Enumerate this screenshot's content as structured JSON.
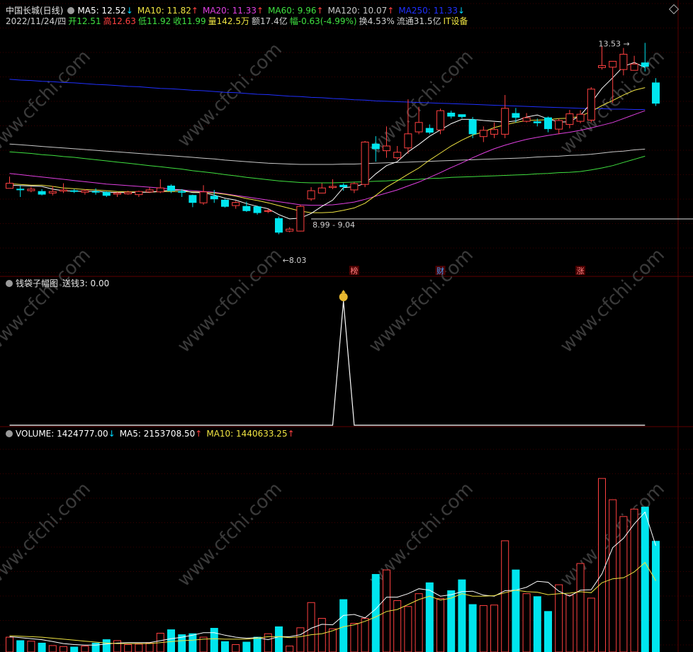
{
  "header": {
    "stock_name": "中国长城(日线)",
    "ma_lines": [
      {
        "label": "MA5: 12.52",
        "arrow": "↓",
        "color": "#ffffff",
        "arrow_color": "#00d8ff"
      },
      {
        "label": "MA10: 11.82",
        "arrow": "↑",
        "color": "#f0e442",
        "arrow_color": "#ff4040"
      },
      {
        "label": "MA20: 11.33",
        "arrow": "↑",
        "color": "#e040e0",
        "arrow_color": "#ff4040"
      },
      {
        "label": "MA60: 9.96",
        "arrow": "↑",
        "color": "#40e040",
        "arrow_color": "#ff4040"
      },
      {
        "label": "MA120: 10.07",
        "arrow": "↑",
        "color": "#c8c8c8",
        "arrow_color": "#ff4040"
      },
      {
        "label": "MA250: 11.33",
        "arrow": "↓",
        "color": "#2030ff",
        "arrow_color": "#00d8ff"
      }
    ],
    "info": [
      {
        "text": "2022/11/24/四",
        "color": "#d0d0d0"
      },
      {
        "text": "开12.51",
        "color": "#40e040"
      },
      {
        "text": "高12.63",
        "color": "#ff4040"
      },
      {
        "text": "低11.92",
        "color": "#40e040"
      },
      {
        "text": "收11.99",
        "color": "#40e040"
      },
      {
        "text": "量142.5万",
        "color": "#f0e442"
      },
      {
        "text": "额17.4亿",
        "color": "#d0d0d0"
      },
      {
        "text": "幅-0.63(-4.99%)",
        "color": "#40e040"
      },
      {
        "text": "换4.53%",
        "color": "#d0d0d0"
      },
      {
        "text": "流通31.5亿",
        "color": "#d0d0d0"
      },
      {
        "text": "IT设备",
        "color": "#f0e442"
      }
    ]
  },
  "indicator": {
    "name": "钱袋子幅图",
    "value": "送钱3: 0.00",
    "signal_icon": "money-bag-icon"
  },
  "volume_header": {
    "items": [
      {
        "label": "VOLUME: 1424777.00",
        "arrow": "↓",
        "color": "#ffffff",
        "arrow_color": "#00d8ff"
      },
      {
        "label": "MA5: 2153708.50",
        "arrow": "↑",
        "color": "#ffffff",
        "arrow_color": "#ff4040"
      },
      {
        "label": "MA10: 1440633.25",
        "arrow": "↑",
        "color": "#f0e442",
        "arrow_color": "#ff4040"
      }
    ]
  },
  "annotations": {
    "low_label": "8.03",
    "high_label": "13.53",
    "range_label": "8.99 - 9.04",
    "events": [
      {
        "idx": 32,
        "text": "榜"
      },
      {
        "idx": 40,
        "text": "财"
      },
      {
        "idx": 53,
        "text": "涨"
      }
    ]
  },
  "watermark": "www.cfchi.com",
  "colors": {
    "up": "#ff4040",
    "down": "#00e5ee",
    "ma5": "#ffffff",
    "ma10": "#f0e442",
    "ma20": "#e040e0",
    "ma60": "#40e040",
    "ma120": "#c8c8c8",
    "ma250": "#2030ff"
  },
  "chart_data": {
    "type": "candlestick",
    "title": "中国长城(日线)",
    "price_range": [
      7.9,
      13.9
    ],
    "candles": [
      [
        9.82,
        9.95,
        10.12,
        9.85
      ],
      [
        9.8,
        9.79,
        9.88,
        9.6
      ],
      [
        9.76,
        9.8,
        9.86,
        9.72
      ],
      [
        9.74,
        9.67,
        9.8,
        9.64
      ],
      [
        9.7,
        9.74,
        9.88,
        9.64
      ],
      [
        9.75,
        9.78,
        9.95,
        9.7
      ],
      [
        9.76,
        9.74,
        9.8,
        9.7
      ],
      [
        9.72,
        9.76,
        9.8,
        9.66
      ],
      [
        9.74,
        9.73,
        9.82,
        9.66
      ],
      [
        9.72,
        9.64,
        9.74,
        9.6
      ],
      [
        9.67,
        9.7,
        9.73,
        9.6
      ],
      [
        9.68,
        9.72,
        9.76,
        9.66
      ],
      [
        9.66,
        9.74,
        9.76,
        9.6
      ],
      [
        9.73,
        9.78,
        9.84,
        9.7
      ],
      [
        9.73,
        9.83,
        10.05,
        9.7
      ],
      [
        9.88,
        9.76,
        9.92,
        9.7
      ],
      [
        9.74,
        9.72,
        9.8,
        9.6
      ],
      [
        9.64,
        9.46,
        9.66,
        9.34
      ],
      [
        9.45,
        9.73,
        9.9,
        9.4
      ],
      [
        9.62,
        9.55,
        9.78,
        9.45
      ],
      [
        9.52,
        9.36,
        9.55,
        9.33
      ],
      [
        9.38,
        9.46,
        9.5,
        9.3
      ],
      [
        9.36,
        9.25,
        9.48,
        9.22
      ],
      [
        9.35,
        9.2,
        9.38,
        9.15
      ],
      [
        9.24,
        9.25,
        9.3,
        9.19
      ],
      [
        9.05,
        8.7,
        9.1,
        8.65
      ],
      [
        8.73,
        8.78,
        8.83,
        8.7
      ],
      [
        8.73,
        9.36,
        9.4,
        8.72
      ],
      [
        9.55,
        9.76,
        9.85,
        9.5
      ],
      [
        9.7,
        9.83,
        9.95,
        9.7
      ],
      [
        9.84,
        9.87,
        10.05,
        9.8
      ],
      [
        9.9,
        9.86,
        9.95,
        9.76
      ],
      [
        9.78,
        9.94,
        9.98,
        9.7
      ],
      [
        9.92,
        11.0,
        11.03,
        9.85
      ],
      [
        10.95,
        10.83,
        11.15,
        10.5
      ],
      [
        10.78,
        10.9,
        11.4,
        10.6
      ],
      [
        10.6,
        10.74,
        10.9,
        10.55
      ],
      [
        10.85,
        11.21,
        12.09,
        10.7
      ],
      [
        11.26,
        11.5,
        11.9,
        11.2
      ],
      [
        11.35,
        11.25,
        11.45,
        11.2
      ],
      [
        11.31,
        11.8,
        11.85,
        11.2
      ],
      [
        11.74,
        11.66,
        11.8,
        11.6
      ],
      [
        11.7,
        11.65,
        11.7,
        11.6
      ],
      [
        11.57,
        11.21,
        11.64,
        11.1
      ],
      [
        11.14,
        11.3,
        11.4,
        11.0
      ],
      [
        11.2,
        11.32,
        11.5,
        11.1
      ],
      [
        11.2,
        11.86,
        12.2,
        11.1
      ],
      [
        11.73,
        11.63,
        11.87,
        11.5
      ],
      [
        11.53,
        11.62,
        11.74,
        11.5
      ],
      [
        11.52,
        11.49,
        11.6,
        11.4
      ],
      [
        11.62,
        11.34,
        11.65,
        11.25
      ],
      [
        11.33,
        11.55,
        11.6,
        11.2
      ],
      [
        11.45,
        11.72,
        11.82,
        11.35
      ],
      [
        11.53,
        11.71,
        11.81,
        11.48
      ],
      [
        11.56,
        12.35,
        12.4,
        11.5
      ],
      [
        12.9,
        12.95,
        13.45,
        12.85
      ],
      [
        12.91,
        13.06,
        13.06,
        12.0
      ],
      [
        12.85,
        13.24,
        13.4,
        12.7
      ],
      [
        12.83,
        12.99,
        13.2,
        12.85
      ],
      [
        13.02,
        12.93,
        13.53,
        12.8
      ],
      [
        12.51,
        11.99,
        12.63,
        11.92
      ]
    ],
    "ma5": [
      9.9,
      9.89,
      9.88,
      9.87,
      9.8,
      9.76,
      9.75,
      9.74,
      9.75,
      9.72,
      9.71,
      9.71,
      9.72,
      9.72,
      9.75,
      9.77,
      9.78,
      9.71,
      9.71,
      9.65,
      9.57,
      9.52,
      9.43,
      9.36,
      9.3,
      9.15,
      9.04,
      9.06,
      9.18,
      9.36,
      9.52,
      9.84,
      9.86,
      9.94,
      10.19,
      10.4,
      10.5,
      10.75,
      10.94,
      11.15,
      11.31,
      11.47,
      11.58,
      11.58,
      11.55,
      11.53,
      11.51,
      11.54,
      11.64,
      11.69,
      11.59,
      11.51,
      11.52,
      11.68,
      12.0,
      12.37,
      12.64,
      12.93,
      13.03,
      12.9,
      12.52
    ],
    "ma10": [
      9.94,
      9.92,
      9.9,
      9.9,
      9.87,
      9.83,
      9.81,
      9.79,
      9.78,
      9.76,
      9.74,
      9.73,
      9.73,
      9.72,
      9.74,
      9.74,
      9.74,
      9.73,
      9.72,
      9.7,
      9.67,
      9.62,
      9.56,
      9.51,
      9.45,
      9.38,
      9.31,
      9.24,
      9.2,
      9.2,
      9.21,
      9.26,
      9.32,
      9.44,
      9.64,
      9.85,
      10.01,
      10.18,
      10.34,
      10.54,
      10.72,
      10.9,
      11.05,
      11.18,
      11.26,
      11.37,
      11.44,
      11.5,
      11.55,
      11.56,
      11.57,
      11.6,
      11.61,
      11.66,
      11.78,
      11.93,
      12.06,
      12.2,
      12.32,
      12.39,
      11.82
    ],
    "ma20": [
      10.2,
      10.17,
      10.14,
      10.11,
      10.08,
      10.05,
      10.02,
      9.99,
      9.96,
      9.93,
      9.91,
      9.89,
      9.87,
      9.85,
      9.83,
      9.8,
      9.78,
      9.76,
      9.74,
      9.72,
      9.68,
      9.64,
      9.6,
      9.56,
      9.52,
      9.48,
      9.44,
      9.4,
      9.39,
      9.39,
      9.4,
      9.43,
      9.47,
      9.54,
      9.62,
      9.7,
      9.78,
      9.88,
      9.98,
      10.1,
      10.22,
      10.35,
      10.47,
      10.6,
      10.72,
      10.83,
      10.92,
      11.0,
      11.07,
      11.12,
      11.17,
      11.21,
      11.25,
      11.3,
      11.36,
      11.43,
      11.5,
      11.6,
      11.7,
      11.8,
      11.33
    ],
    "ma60": [
      10.75,
      10.73,
      10.71,
      10.68,
      10.66,
      10.63,
      10.61,
      10.58,
      10.55,
      10.52,
      10.49,
      10.46,
      10.43,
      10.4,
      10.37,
      10.34,
      10.31,
      10.27,
      10.24,
      10.21,
      10.17,
      10.14,
      10.1,
      10.07,
      10.04,
      10.01,
      9.99,
      9.97,
      9.96,
      9.96,
      9.96,
      9.97,
      9.98,
      9.99,
      10.0,
      10.01,
      10.03,
      10.04,
      10.05,
      10.07,
      10.08,
      10.1,
      10.11,
      10.12,
      10.13,
      10.14,
      10.15,
      10.16,
      10.17,
      10.19,
      10.2,
      10.22,
      10.23,
      10.25,
      10.29,
      10.34,
      10.4,
      10.48,
      10.56,
      10.64,
      9.96
    ],
    "ma120": [
      10.95,
      10.93,
      10.91,
      10.89,
      10.87,
      10.85,
      10.83,
      10.81,
      10.79,
      10.77,
      10.75,
      10.73,
      10.71,
      10.69,
      10.67,
      10.65,
      10.63,
      10.61,
      10.59,
      10.57,
      10.54,
      10.52,
      10.5,
      10.48,
      10.46,
      10.45,
      10.44,
      10.43,
      10.43,
      10.43,
      10.43,
      10.44,
      10.44,
      10.45,
      10.46,
      10.47,
      10.48,
      10.49,
      10.5,
      10.51,
      10.52,
      10.53,
      10.54,
      10.55,
      10.56,
      10.57,
      10.58,
      10.59,
      10.6,
      10.62,
      10.63,
      10.64,
      10.66,
      10.67,
      10.69,
      10.72,
      10.75,
      10.77,
      10.8,
      10.82,
      10.07
    ],
    "ma250": [
      12.6,
      12.58,
      12.57,
      12.55,
      12.54,
      12.52,
      12.51,
      12.49,
      12.47,
      12.46,
      12.44,
      12.42,
      12.41,
      12.39,
      12.37,
      12.36,
      12.34,
      12.32,
      12.31,
      12.29,
      12.27,
      12.26,
      12.24,
      12.22,
      12.21,
      12.19,
      12.17,
      12.16,
      12.14,
      12.13,
      12.11,
      12.1,
      12.08,
      12.07,
      12.05,
      12.04,
      12.03,
      12.02,
      12.01,
      12.0,
      11.99,
      11.98,
      11.97,
      11.96,
      11.95,
      11.94,
      11.93,
      11.92,
      11.91,
      11.9,
      11.89,
      11.88,
      11.87,
      11.86,
      11.85,
      11.85,
      11.84,
      11.84,
      11.83,
      11.83,
      11.33
    ],
    "signal": [
      0,
      0,
      0,
      0,
      0,
      0,
      0,
      0,
      0,
      0,
      0,
      0,
      0,
      0,
      0,
      0,
      0,
      0,
      0,
      0,
      0,
      0,
      0,
      0,
      0,
      0,
      0,
      0,
      0,
      0,
      0,
      3,
      0,
      0,
      0,
      0,
      0,
      0,
      0,
      0,
      0,
      0,
      0,
      0,
      0,
      0,
      0,
      0,
      0,
      0,
      0,
      0,
      0,
      0,
      0,
      0,
      0,
      0,
      0,
      0,
      0
    ],
    "volume": [
      300000,
      230000,
      220000,
      180000,
      130000,
      110000,
      100000,
      120000,
      180000,
      250000,
      230000,
      150000,
      160000,
      180000,
      380000,
      450000,
      350000,
      370000,
      300000,
      480000,
      210000,
      150000,
      200000,
      300000,
      370000,
      510000,
      120000,
      490000,
      1000000,
      680000,
      470000,
      1060000,
      580000,
      680000,
      1570000,
      1660000,
      1040000,
      920000,
      1180000,
      1400000,
      1080000,
      1240000,
      1460000,
      960000,
      940000,
      950000,
      2250000,
      1660000,
      1180000,
      1120000,
      820000,
      1360000,
      1150000,
      1790000,
      1090000,
      3510000,
      3080000,
      2740000,
      2890000,
      2930000,
      2240000
    ],
    "vol_ma5": [
      310000,
      290000,
      270000,
      250000,
      210000,
      170000,
      150000,
      140000,
      140000,
      160000,
      180000,
      190000,
      190000,
      190000,
      230000,
      270000,
      300000,
      340000,
      390000,
      390000,
      340000,
      300000,
      280000,
      290000,
      250000,
      310000,
      310000,
      350000,
      480000,
      560000,
      550000,
      740000,
      760000,
      690000,
      870000,
      1110000,
      1110000,
      1180000,
      1280000,
      1250000,
      1130000,
      1160000,
      1220000,
      1230000,
      1150000,
      1130000,
      1240000,
      1250000,
      1310000,
      1430000,
      1410000,
      1230000,
      1130000,
      1250000,
      1260000,
      1580000,
      2110000,
      2300000,
      2590000,
      2830000,
      2150000
    ],
    "vol_ma10": [
      330000,
      320000,
      310000,
      300000,
      280000,
      260000,
      240000,
      220000,
      200000,
      180000,
      170000,
      170000,
      170000,
      170000,
      190000,
      210000,
      230000,
      240000,
      260000,
      270000,
      260000,
      260000,
      260000,
      280000,
      310000,
      310000,
      290000,
      310000,
      350000,
      370000,
      430000,
      510000,
      550000,
      620000,
      710000,
      820000,
      860000,
      960000,
      1060000,
      1130000,
      1050000,
      1090000,
      1180000,
      1130000,
      1130000,
      1140000,
      1200000,
      1250000,
      1220000,
      1210000,
      1160000,
      1180000,
      1190000,
      1220000,
      1200000,
      1400000,
      1480000,
      1500000,
      1620000,
      1810000,
      1440000
    ],
    "vol_range": [
      0,
      4300000
    ]
  }
}
